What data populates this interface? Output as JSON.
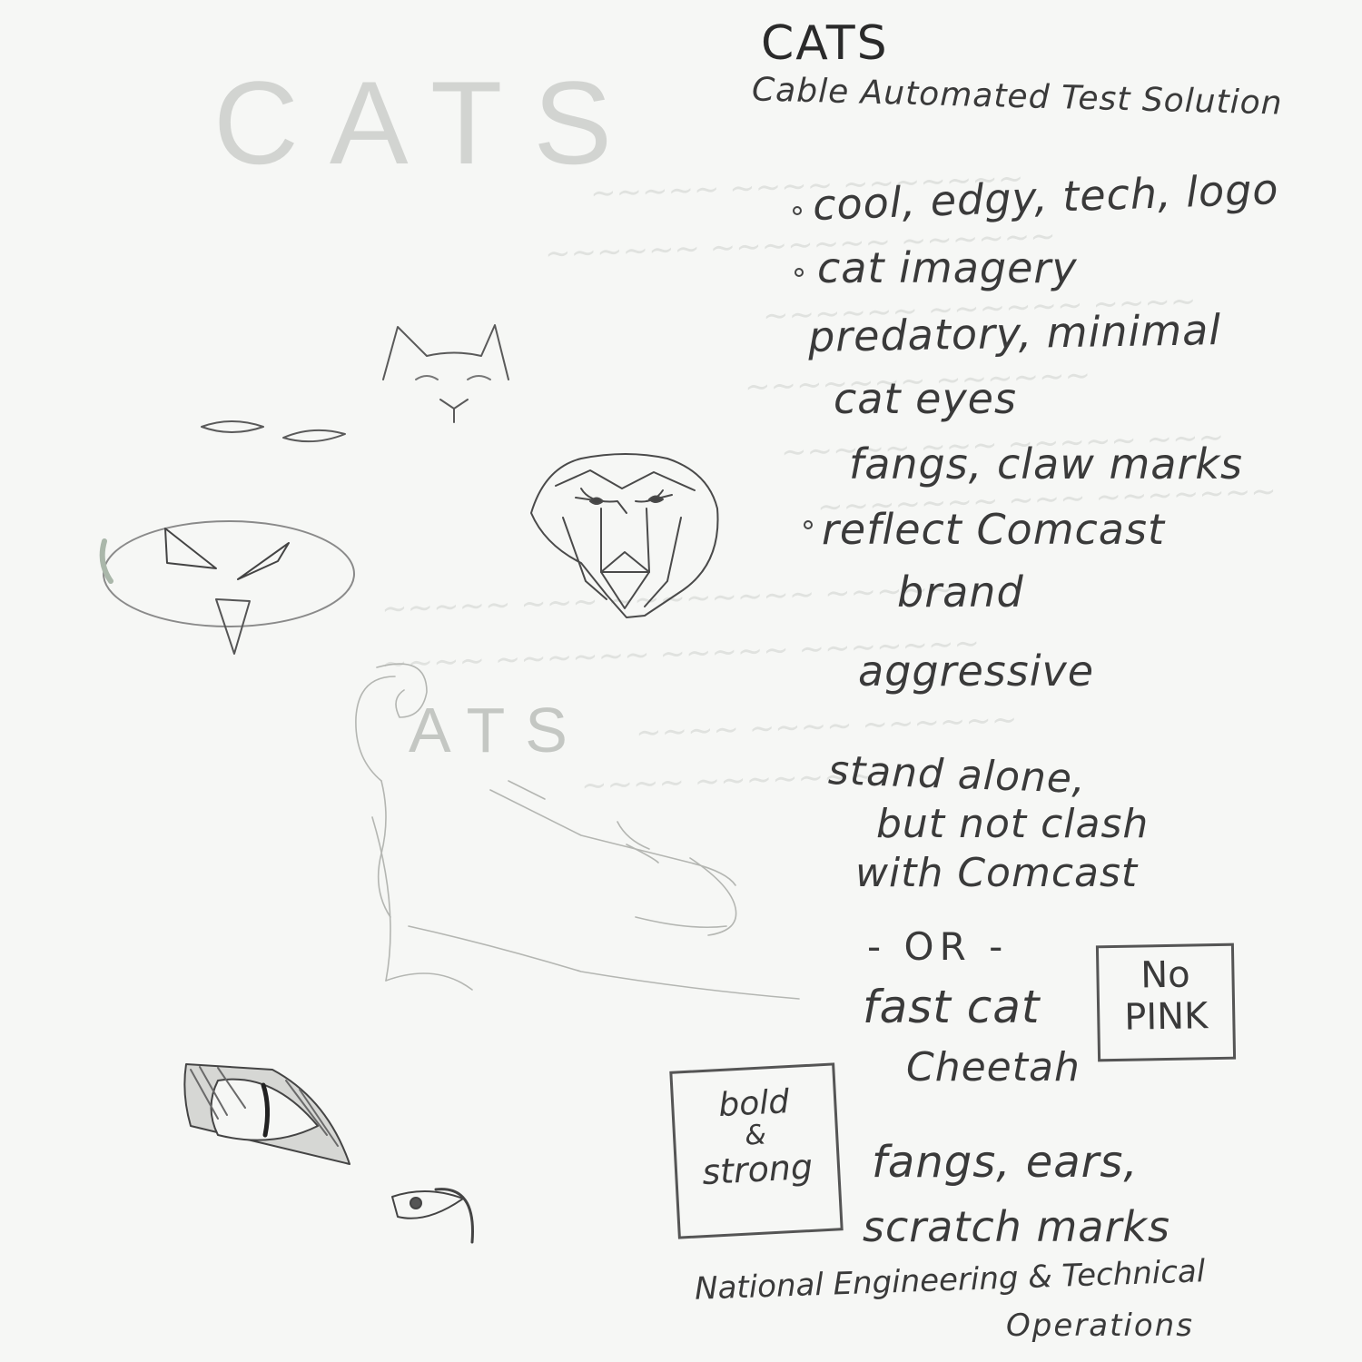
{
  "sketch_lettering": "CATS",
  "title": "CATS",
  "subtitle": "Cable Automated Test Solution",
  "notes": [
    "cool, edgy, tech, logo",
    "cat imagery",
    "predatory, minimal",
    "cat eyes",
    "fangs, claw marks",
    "reflect Comcast",
    "brand",
    "aggressive",
    "stand alone,",
    "but not clash",
    "with Comcast",
    "- OR -",
    "fast cat",
    "Cheetah",
    "fangs, ears,",
    "scratch marks"
  ],
  "box_no_pink": [
    "No",
    "PINK"
  ],
  "box_bold": [
    "bold",
    "&",
    "strong"
  ],
  "footer": [
    "National Engineering & Technical",
    "Operations"
  ],
  "colors": {
    "paper": "#f6f7f5",
    "pencil": "#3a3a3a",
    "faint_pencil": "#c4c7c3"
  }
}
